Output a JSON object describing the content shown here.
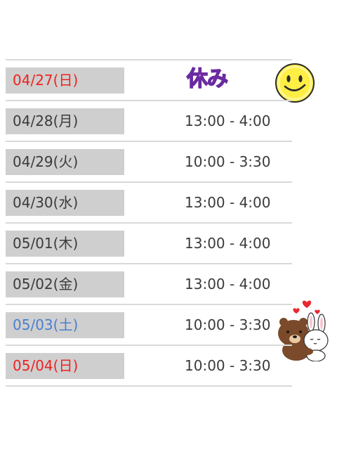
{
  "schedule": {
    "rows": [
      {
        "date": "04/27(日)",
        "hours": "",
        "note": "休み"
      },
      {
        "date": "04/28(月)",
        "hours": "13:00 - 4:00"
      },
      {
        "date": "04/29(火)",
        "hours": "10:00 - 3:30"
      },
      {
        "date": "04/30(水)",
        "hours": "13:00 - 4:00"
      },
      {
        "date": "05/01(木)",
        "hours": "13:00 - 4:00"
      },
      {
        "date": "05/02(金)",
        "hours": "13:00 - 4:00"
      },
      {
        "date": "05/03(土)",
        "hours": "10:00 - 3:30"
      },
      {
        "date": "05/04(日)",
        "hours": "10:00 - 3:30"
      }
    ]
  },
  "colors": {
    "sunday": "#ee2222",
    "saturday": "#4a7fd0",
    "weekday": "#3b3b3b",
    "date_cell_bg": "#cfcfcf",
    "holiday_text": "#e867e8"
  },
  "stickers": {
    "row0": "smiley-face-icon",
    "row6": "brown-bear-and-cony-bunny-hug-sticker"
  }
}
